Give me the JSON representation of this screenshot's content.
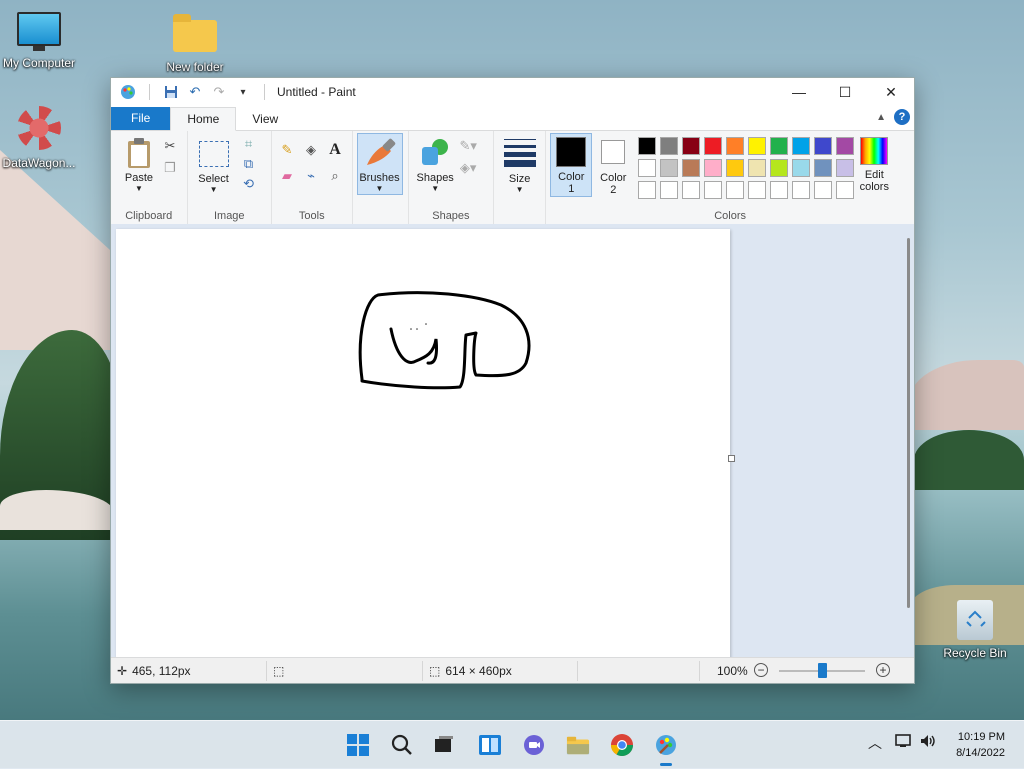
{
  "desktop": {
    "icons": [
      {
        "label": "My Computer",
        "icon": "computer-icon"
      },
      {
        "label": "New folder",
        "icon": "folder-icon"
      },
      {
        "label": "DataWagon...",
        "icon": "datawagon-icon"
      },
      {
        "label": "Recycle Bin",
        "icon": "recycle-bin-icon"
      }
    ]
  },
  "window": {
    "title": "Untitled - Paint",
    "controls": {
      "minimize": "—",
      "maximize": "☐",
      "close": "✕"
    }
  },
  "tabs": {
    "file": "File",
    "home": "Home",
    "view": "View",
    "help": "?"
  },
  "ribbon": {
    "clipboard": {
      "label": "Clipboard",
      "paste": "Paste"
    },
    "image": {
      "label": "Image",
      "select": "Select"
    },
    "tools": {
      "label": "Tools"
    },
    "brushes": {
      "label": "Brushes"
    },
    "shapes": {
      "label": "Shapes",
      "button": "Shapes"
    },
    "size": {
      "label": "Size"
    },
    "colors": {
      "label": "Colors",
      "color1": "Color",
      "color1_num": "1",
      "color2": "Color",
      "color2_num": "2",
      "edit_line1": "Edit",
      "edit_line2": "colors",
      "color1_value": "#000000",
      "color2_value": "#ffffff",
      "palette_row1": [
        "#000000",
        "#7f7f7f",
        "#880015",
        "#ed1c24",
        "#ff7f27",
        "#fff200",
        "#22b14c",
        "#00a2e8",
        "#3f48cc",
        "#a349a4"
      ],
      "palette_row2": [
        "#ffffff",
        "#c3c3c3",
        "#b97a57",
        "#ffaec9",
        "#ffc90e",
        "#efe4b0",
        "#b5e61d",
        "#99d9ea",
        "#7092be",
        "#c8bfe7"
      ],
      "palette_row3": [
        "#ffffff",
        "#ffffff",
        "#ffffff",
        "#ffffff",
        "#ffffff",
        "#ffffff",
        "#ffffff",
        "#ffffff",
        "#ffffff",
        "#ffffff"
      ]
    }
  },
  "status": {
    "cursor_pos": "465, 112px",
    "image_size": "614 × 460px",
    "zoom": "100%",
    "zoom_fraction": 0.5
  },
  "taskbar": {
    "time": "10:19 PM",
    "date": "8/14/2022"
  }
}
